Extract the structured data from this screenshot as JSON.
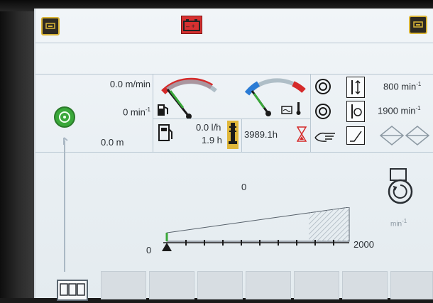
{
  "left_panel": {
    "speed": "0.0 m/min",
    "rpm_value": "0 min",
    "rpm_exp": "-1",
    "distance": "0.0 m"
  },
  "fuel": {
    "rate": "0.0 l/h",
    "hours": "1.9 h"
  },
  "operating_hours": "3989.1h",
  "settings": {
    "rpm_low_value": "800 min",
    "rpm_high_value": "1900 min",
    "exp": "-1"
  },
  "gauge": {
    "current_value": "0",
    "current_fraction": 0,
    "scale_min": "0",
    "scale_max": "2000",
    "unit": "min",
    "unit_exp": "-1"
  },
  "colors": {
    "active_green": "#3aa83a",
    "gauge_red": "#d52a2a",
    "gauge_blue": "#2a7bd5",
    "warning_yellow": "#e0b73a"
  },
  "icons": [
    "rotor-icon",
    "fuel-pump-icon",
    "coolant-temperature-icon",
    "fuel-refill-icon",
    "hour-meter-icon",
    "hourglass-icon",
    "rotation-icon",
    "spacing-adjust-icon",
    "rotation-speed-icon",
    "hand-icon",
    "incline-icon",
    "diamond-arrows-icon",
    "battery-warning-icon",
    "menu-icon",
    "engine-icon"
  ]
}
